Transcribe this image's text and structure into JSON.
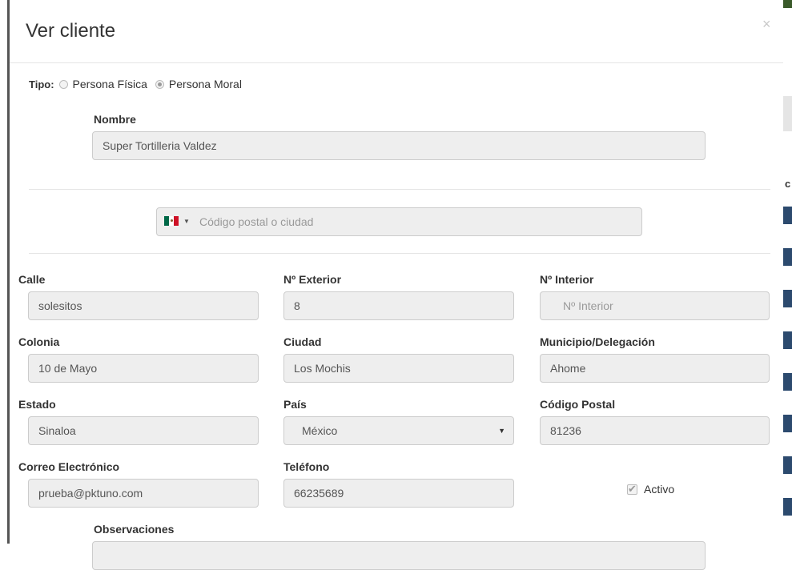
{
  "modal": {
    "title": "Ver cliente",
    "close_symbol": "×"
  },
  "tipo": {
    "label": "Tipo:",
    "options": [
      "Persona Física",
      "Persona Moral"
    ],
    "selected": "Persona Moral"
  },
  "nombre": {
    "label": "Nombre",
    "value": "Super Tortilleria Valdez"
  },
  "postal_search": {
    "placeholder": "Código postal o ciudad",
    "flag": "mexico-flag-icon"
  },
  "address": {
    "calle": {
      "label": "Calle",
      "value": "solesitos"
    },
    "exterior": {
      "label": "Nº Exterior",
      "value": "8"
    },
    "interior": {
      "label": "Nº Interior",
      "placeholder": "Nº Interior"
    },
    "colonia": {
      "label": "Colonia",
      "value": "10 de Mayo"
    },
    "ciudad": {
      "label": "Ciudad",
      "value": "Los Mochis"
    },
    "municipio": {
      "label": "Municipio/Delegación",
      "value": "Ahome"
    },
    "estado": {
      "label": "Estado",
      "value": "Sinaloa"
    },
    "pais": {
      "label": "País",
      "value": "México"
    },
    "codigo_postal": {
      "label": "Código Postal",
      "value": "81236"
    }
  },
  "contact": {
    "correo": {
      "label": "Correo Electrónico",
      "value": "prueba@pktuno.com"
    },
    "telefono": {
      "label": "Teléfono",
      "value": "66235689"
    },
    "activo": {
      "label": "Activo",
      "checked": true
    }
  },
  "observaciones": {
    "label": "Observaciones"
  },
  "background_partial_letter": "c"
}
